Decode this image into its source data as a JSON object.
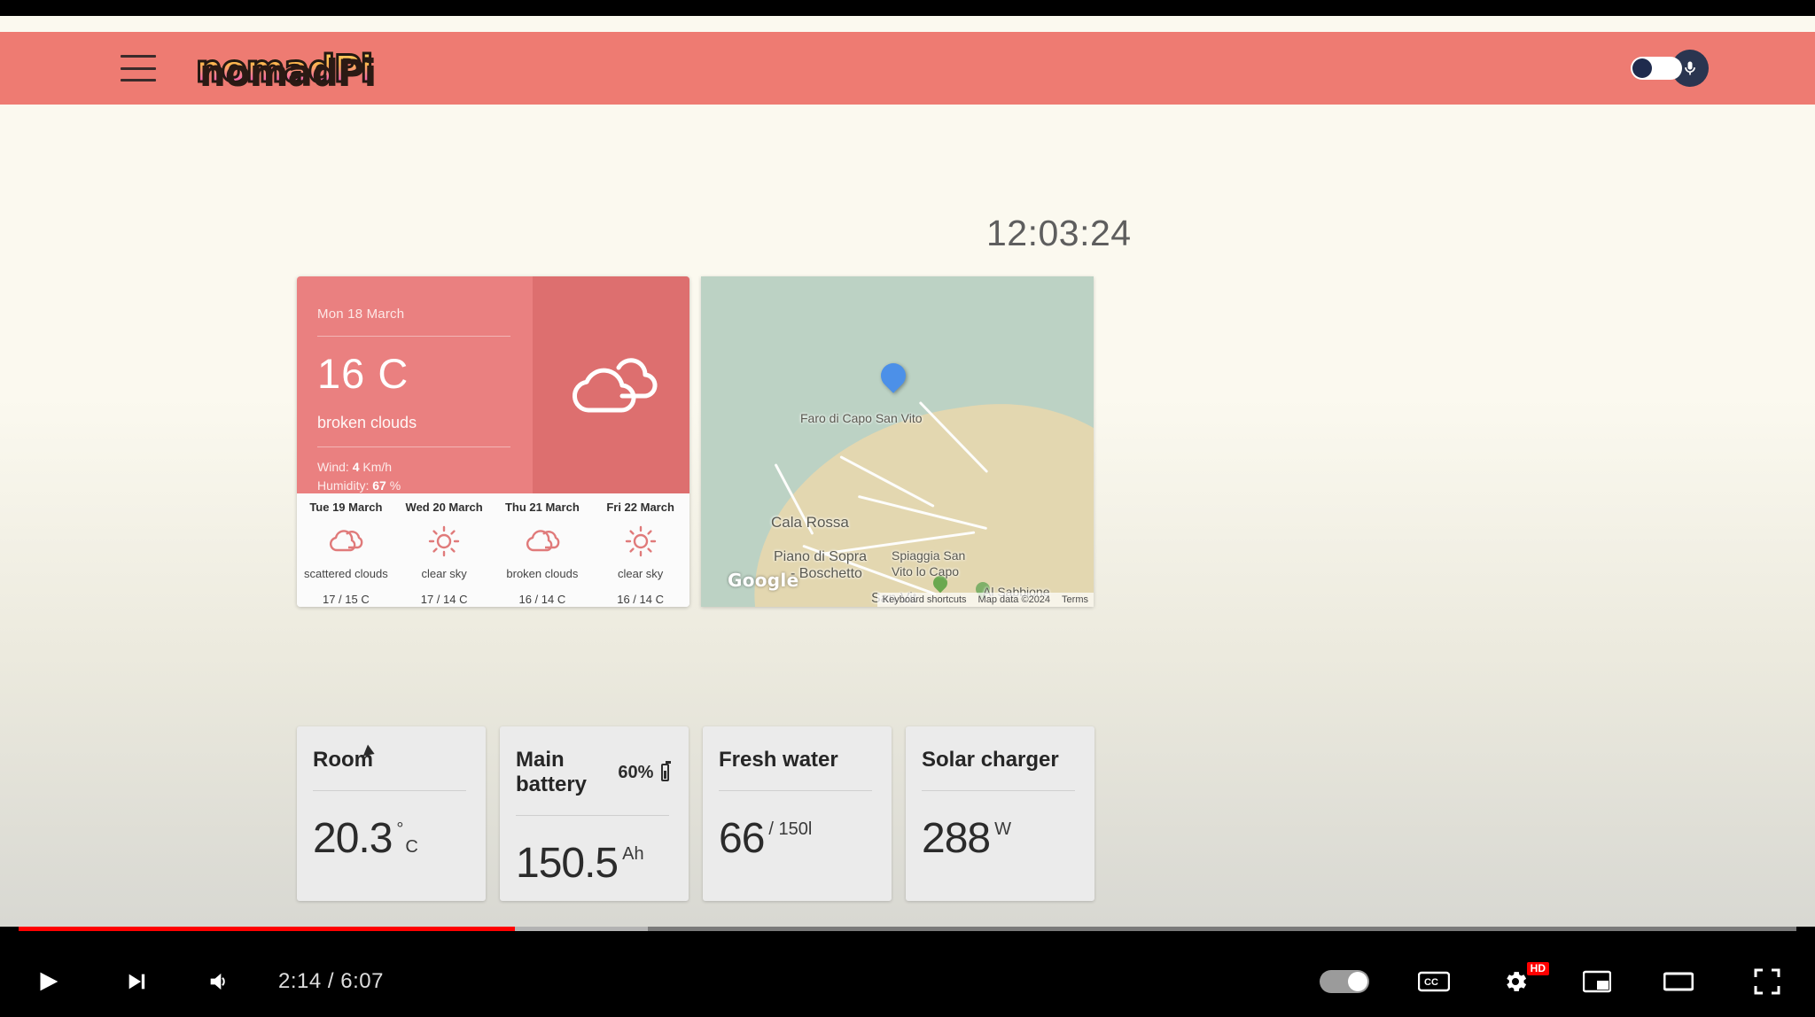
{
  "appbar": {
    "menu_icon": "hamburger-menu-icon",
    "logo_text": "nomadPi",
    "toggle_icon": "power-toggle",
    "mic_icon": "microphone-icon"
  },
  "clock": {
    "time": "12:03:24"
  },
  "weather": {
    "current": {
      "date": "Mon 18 March",
      "temperature": "16 C",
      "description": "broken clouds",
      "wind_label": "Wind:",
      "wind_value": "4",
      "wind_unit": "Km/h",
      "humidity_label": "Humidity:",
      "humidity_value": "67",
      "humidity_unit": "%",
      "icon": "broken-clouds-icon"
    },
    "forecast": [
      {
        "day": "Tue 19 March",
        "icon": "scattered-clouds-icon",
        "description": "scattered clouds",
        "temps": "17 / 15 C"
      },
      {
        "day": "Wed 20 March",
        "icon": "clear-sky-icon",
        "description": "clear sky",
        "temps": "17 / 14 C"
      },
      {
        "day": "Thu 21 March",
        "icon": "broken-clouds-icon",
        "description": "broken clouds",
        "temps": "16 / 14 C"
      },
      {
        "day": "Fri 22 March",
        "icon": "clear-sky-icon",
        "description": "clear sky",
        "temps": "16 / 14 C"
      }
    ]
  },
  "map": {
    "labels": [
      "Faro di Capo San Vito",
      "Cala Rossa",
      "Piano di Sopra",
      "- Boschetto",
      "Spiaggia San",
      "Vito lo Capo",
      "San Vit",
      "Al Sabbione"
    ],
    "watermark": "Google",
    "attribution": {
      "shortcuts": "Keyboard shortcuts",
      "data": "Map data ©2024",
      "terms": "Terms"
    }
  },
  "stats": [
    {
      "title": "Room",
      "badge": "",
      "value": "20.3",
      "unit_sup": "°",
      "unit": "C"
    },
    {
      "title": "Main battery",
      "badge": "60%",
      "value": "150.5",
      "unit_sup": "",
      "unit": "Ah"
    },
    {
      "title": "Fresh water",
      "badge": "",
      "value": "66",
      "unit_sup": "",
      "unit": "/ 150l"
    },
    {
      "title": "Solar charger",
      "badge": "",
      "value": "288",
      "unit_sup": "",
      "unit": "W"
    }
  ],
  "player": {
    "play_icon": "play-icon",
    "next_icon": "next-video-icon",
    "volume_icon": "volume-icon",
    "time": "2:14 / 6:07",
    "autoplay_icon": "autoplay-toggle",
    "captions_icon": "closed-captions-icon",
    "hd_badge": "HD",
    "settings_icon": "gear-icon",
    "miniplayer_icon": "miniplayer-icon",
    "theater_icon": "theater-mode-icon",
    "fullscreen_icon": "fullscreen-icon"
  },
  "colors": {
    "accent": "#ea8080",
    "header": "#ee7b72",
    "progress": "#ff0000"
  }
}
